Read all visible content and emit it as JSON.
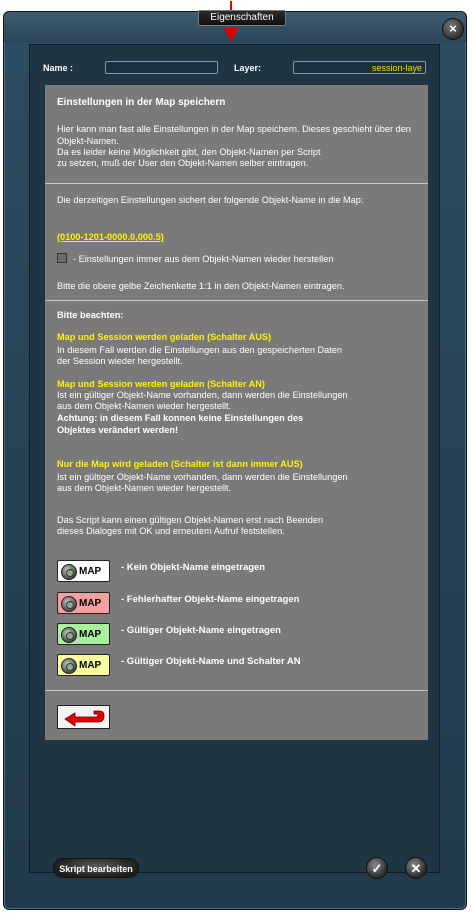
{
  "window": {
    "title": "Eigenschaften",
    "close_icon": "×"
  },
  "fields": {
    "name_label": "Name :",
    "name_value": "",
    "layer_label": "Layer:",
    "layer_value": "session-laye"
  },
  "intro": {
    "heading": "Einstellungen in der Map speichern",
    "p1": "Hier kann man fast alle Einstellungen in der Map speichern. Dieses geschieht über den Objekt-Namen.",
    "p2_l1": "Da es leider keine Möglichkeit gibt, den Objekt-Namen per Script",
    "p2_l2": "zu setzen, muß der User den Objekt-Namen selber eintragen."
  },
  "current": {
    "p1": "Die derzeitigen Einstellungen sichert der folgende Objekt-Name in die Map:",
    "code": "(0100-1201-0000.0,000.5)",
    "checkbox_label": "- Einstellungen immer aus dem Objekt-Namen wieder herstellen",
    "p2": "Bitte die obere gelbe Zeichenkette 1:1 in den Objekt-Namen eintragen."
  },
  "notes": {
    "heading": "Bitte beachten:",
    "case1_title": "Map und Session werden geladen (Schalter AUS)",
    "case1_l1": "In diesem Fall werden die Einstellungen aus den gespeicherten Daten",
    "case1_l2": "der Session wieder hergestellt.",
    "case2_title": "Map und Session werden geladen (Schalter AN)",
    "case2_l1": "Ist ein gültiger Objekt-Name vorhanden, dann werden die Einstellungen",
    "case2_l2": "aus dem Objekt-Namen wieder hergestellt.",
    "case2_warn_l1": "Achtung: in diesem Fall konnen keine Einstellungen des",
    "case2_warn_l2": "Objektes verändert werden!",
    "case3_title": "Nur die Map wird geladen (Schalter ist dann immer AUS)",
    "case3_l1": "Ist ein gültiger Objekt-Name vorhanden, dann werden die Einstellungen",
    "case3_l2": "aus dem Objekt-Namen wieder hergestellt.",
    "final_l1": "Das Script kann einen gültigen Objekt-Namen erst nach Beenden",
    "final_l2": "dieses Dialoges mit OK und erneutem Aufruf feststellen."
  },
  "legend": [
    {
      "button": "MAP",
      "color": "#ffffff",
      "text": "- Kein Objekt-Name eingetragen"
    },
    {
      "button": "MAP",
      "color": "#f5a0a0",
      "text": "- Fehlerhafter Objekt-Name eingetragen"
    },
    {
      "button": "MAP",
      "color": "#a8f0a0",
      "text": "- Gültiger Objekt-Name eingetragen"
    },
    {
      "button": "MAP",
      "color": "#fafaa0",
      "text": "- Gültiger Objekt-Name und Schalter AN"
    }
  ],
  "footer": {
    "edit_script": "Skript bearbeiten",
    "ok_icon": "✓",
    "cancel_icon": "✕"
  }
}
